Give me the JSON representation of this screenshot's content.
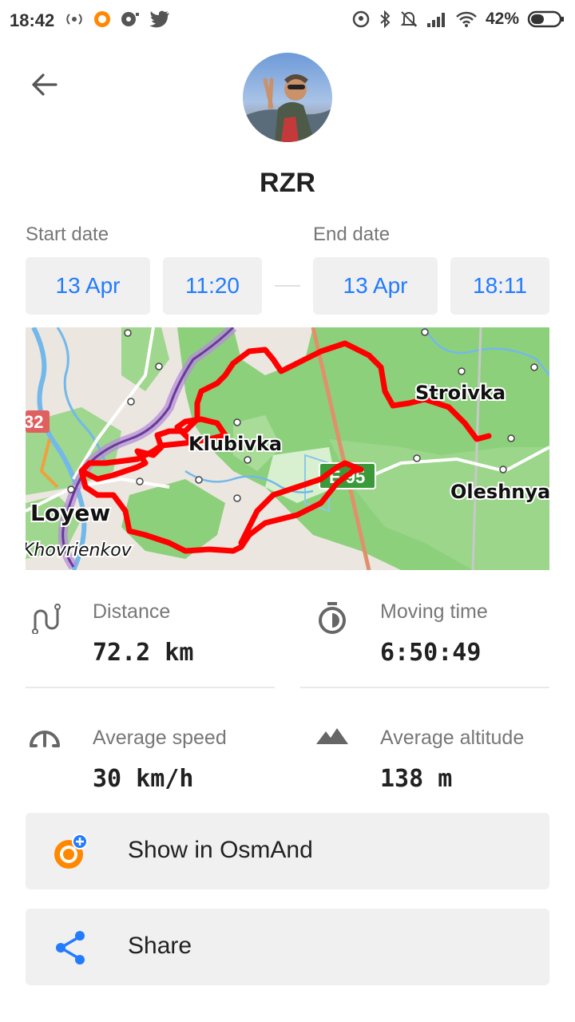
{
  "status_bar": {
    "time": "18:42",
    "battery": "42%",
    "left_icons": [
      "hotspot-icon",
      "osmand-notification-icon",
      "record-icon",
      "twitter-icon"
    ],
    "right_icons": [
      "location-icon",
      "bluetooth-icon",
      "silent-icon",
      "signal-icon",
      "wifi-icon",
      "battery-icon"
    ]
  },
  "header": {
    "back_icon": "arrow-left-icon",
    "user_name": "RZR"
  },
  "dates": {
    "start_label": "Start date",
    "end_label": "End date",
    "start_date": "13 Apr",
    "start_time": "11:20",
    "end_date": "13 Apr",
    "end_time": "18:11"
  },
  "map": {
    "labels": [
      "Stroivka",
      "Klubivka",
      "Oleshnya",
      "Loyew",
      "Khovrienkov"
    ],
    "road_shields": [
      "32",
      "E 95"
    ],
    "route_color": "#ff0000"
  },
  "stats": {
    "distance_label": "Distance",
    "distance_value": "72.2 km",
    "moving_time_label": "Moving time",
    "moving_time_value": "6:50:49",
    "avg_speed_label": "Average speed",
    "avg_speed_value": "30 km/h",
    "avg_altitude_label": "Average altitude",
    "avg_altitude_value": "138 m"
  },
  "actions": {
    "show_label": "Show in OsmAnd",
    "share_label": "Share"
  },
  "colors": {
    "accent": "#237bff",
    "osmand_orange": "#ff8800",
    "button_bg": "#f0f0f0"
  }
}
